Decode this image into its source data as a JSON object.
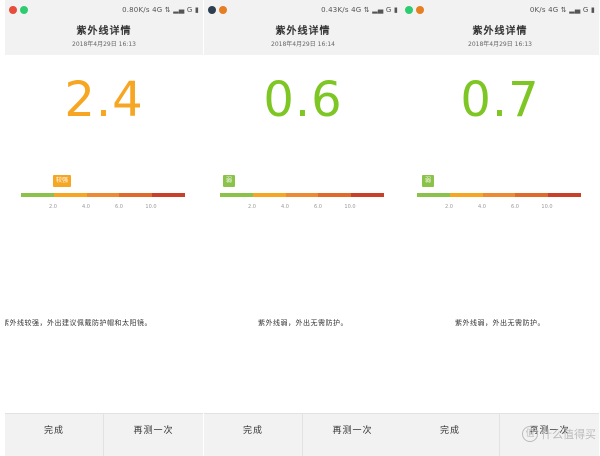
{
  "colors": {
    "value_orange": "#f6a623",
    "value_green": "#7ec624",
    "scale": [
      "#8bc34a",
      "#f5a623",
      "#ef8a34",
      "#e06a2c",
      "#c8402a"
    ]
  },
  "panels": [
    {
      "status_speed": "0.80K/s",
      "status_tail": "4G ⇅ ▂▄ G ▮",
      "title": "紫外线详情",
      "date": "2018年4月29日  16:13",
      "value": "2.4",
      "value_color": "#f6a623",
      "badge_text": "较强",
      "badge_color": "#f5a623",
      "uv_index": 2.4,
      "ticks": [
        "2.0",
        "4.0",
        "6.0",
        "10.0"
      ],
      "advice": "紫外线较强，外出建议佩戴防护帽和太阳镜。",
      "done": "完成",
      "again": "再测一次"
    },
    {
      "status_speed": "0.43K/s",
      "status_tail": "4G ⇅ ▂▄ G ▮",
      "title": "紫外线详情",
      "date": "2018年4月29日  16:14",
      "value": "0.6",
      "value_color": "#7ec624",
      "badge_text": "弱",
      "badge_color": "#8bc34a",
      "uv_index": 0.6,
      "ticks": [
        "2.0",
        "4.0",
        "6.0",
        "10.0"
      ],
      "advice": "紫外线弱，外出无需防护。",
      "done": "完成",
      "again": "再测一次"
    },
    {
      "status_speed": "0K/s",
      "status_tail": "4G ⇅ ▂▄ G ▮",
      "title": "紫外线详情",
      "date": "2018年4月29日  16:13",
      "value": "0.7",
      "value_color": "#7ec624",
      "badge_text": "弱",
      "badge_color": "#8bc34a",
      "uv_index": 0.7,
      "ticks": [
        "2.0",
        "4.0",
        "6.0",
        "10.0"
      ],
      "advice": "紫外线弱，外出无需防护。",
      "done": "完成",
      "again": "再测一次"
    }
  ],
  "watermark": {
    "icon_text": "值",
    "text": "什么值得买"
  }
}
